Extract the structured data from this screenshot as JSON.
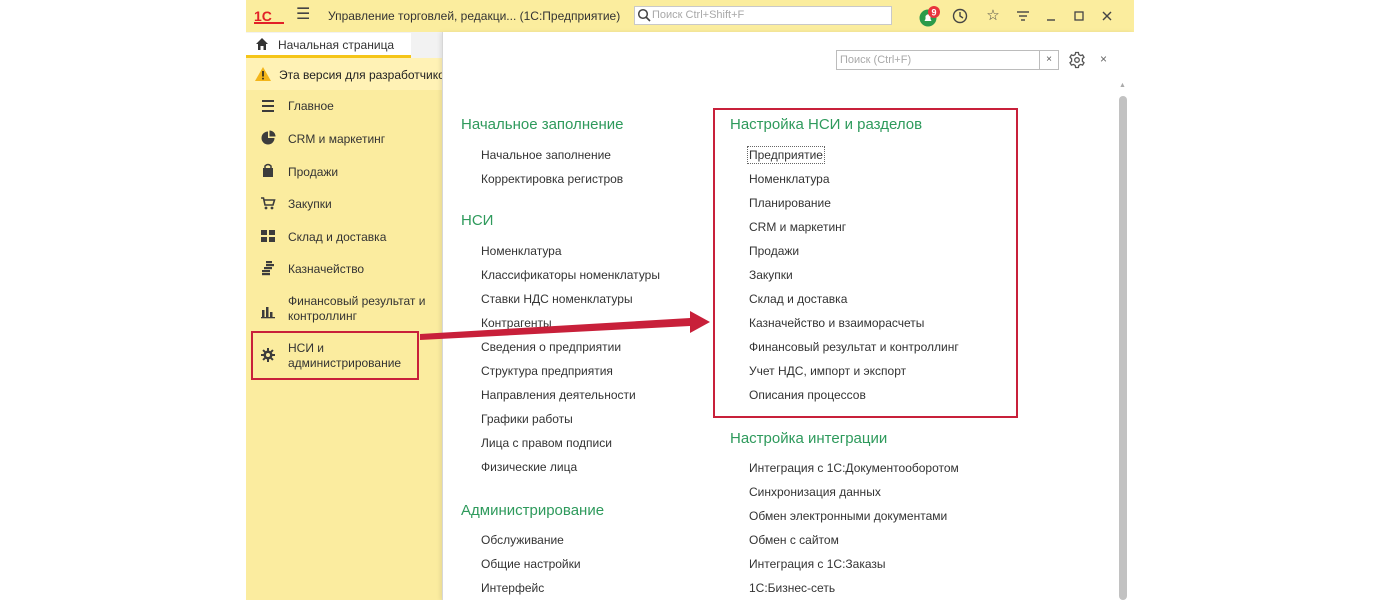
{
  "titlebar": {
    "app_title": "Управление торговлей, редакци...  (1С:Предприятие)",
    "search_placeholder": "Поиск Ctrl+Shift+F",
    "notification_count": "9"
  },
  "tabs": {
    "home_label": "Начальная страница"
  },
  "warning": {
    "text": "Эта версия для разработчиков"
  },
  "sidebar": {
    "items": [
      {
        "label": "Главное",
        "icon": "list-icon"
      },
      {
        "label": "CRM и маркетинг",
        "icon": "pie-chart-icon"
      },
      {
        "label": "Продажи",
        "icon": "shopping-bag-icon"
      },
      {
        "label": "Закупки",
        "icon": "cart-icon"
      },
      {
        "label": "Склад и доставка",
        "icon": "warehouse-icon"
      },
      {
        "label": "Казначейство",
        "icon": "coins-icon"
      },
      {
        "label": "Финансовый результат и контроллинг",
        "icon": "bar-chart-icon"
      },
      {
        "label": "НСИ и администрирование",
        "icon": "gear-icon"
      }
    ]
  },
  "panel": {
    "search_placeholder": "Поиск (Ctrl+F)",
    "clear_label": "×",
    "close_label": "×",
    "left_sections": [
      {
        "title": "Начальное заполнение",
        "links": [
          "Начальное заполнение",
          "Корректировка регистров"
        ]
      },
      {
        "title": "НСИ",
        "links": [
          "Номенклатура",
          "Классификаторы номенклатуры",
          "Ставки НДС номенклатуры",
          "Контрагенты",
          "Сведения о предприятии",
          "Структура предприятия",
          "Направления деятельности",
          "Графики работы",
          "Лица с правом подписи",
          "Физические лица"
        ]
      },
      {
        "title": "Администрирование",
        "links": [
          "Обслуживание",
          "Общие настройки",
          "Интерфейс"
        ]
      }
    ],
    "right_sections": [
      {
        "title": "Настройка НСИ и разделов",
        "links": [
          "Предприятие",
          "Номенклатура",
          "Планирование",
          "CRM и маркетинг",
          "Продажи",
          "Закупки",
          "Склад и доставка",
          "Казначейство и взаиморасчеты",
          "Финансовый результат и контроллинг",
          "Учет НДС, импорт и экспорт",
          "Описания процессов"
        ]
      },
      {
        "title": "Настройка интеграции",
        "links": [
          "Интеграция с 1С:Документооборотом",
          "Синхронизация данных",
          "Обмен электронными документами",
          "Обмен с сайтом",
          "Интеграция с 1С:Заказы",
          "1С:Бизнес-сеть"
        ]
      }
    ]
  },
  "colors": {
    "titlebar_bg": "#fbed9e",
    "sidebar_bg": "#fbec9f",
    "section_heading": "#2e9a5c",
    "highlight_red": "#c8203a",
    "brand_red": "#e22027"
  }
}
